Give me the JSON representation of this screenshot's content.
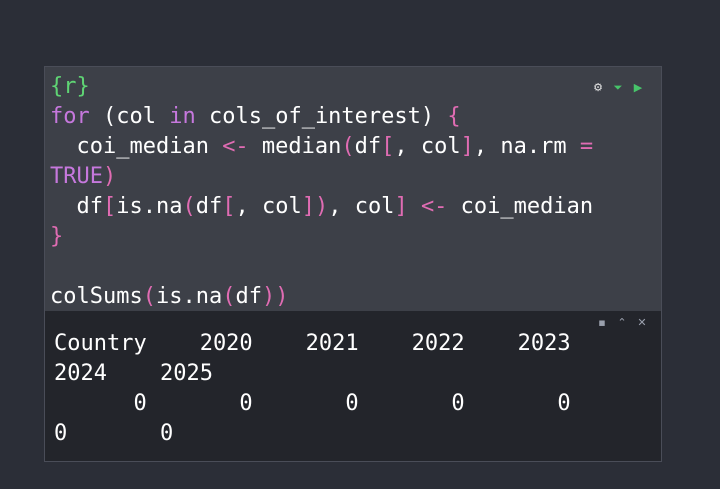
{
  "chunk": {
    "header": "{r}",
    "code_lines": [
      "for (col in cols_of_interest) {",
      "  coi_median <- median(df[, col], na.rm =",
      "TRUE)",
      "  df[is.na(df[, col]), col] <- coi_median",
      "}",
      "",
      "colSums(is.na(df))"
    ],
    "tools": {
      "settings_icon": "gear-icon",
      "run_above_icon": "run-above-icon",
      "run_icon": "play-icon"
    }
  },
  "output": {
    "lines": [
      "Country    2020    2021    2022    2023",
      "2024    2025",
      "      0       0       0       0       0",
      "0       0"
    ],
    "tools": {
      "copy_icon": "copy-icon",
      "collapse_icon": "collapse-icon",
      "close_icon": "close-icon"
    }
  },
  "colors": {
    "background": "#2b2e37",
    "code_background": "#3d4048",
    "output_background": "#23252b",
    "keyword": "#c678dd",
    "operator": "#e06cb3",
    "chunk_header": "#5fd474",
    "run": "#47c46a"
  }
}
